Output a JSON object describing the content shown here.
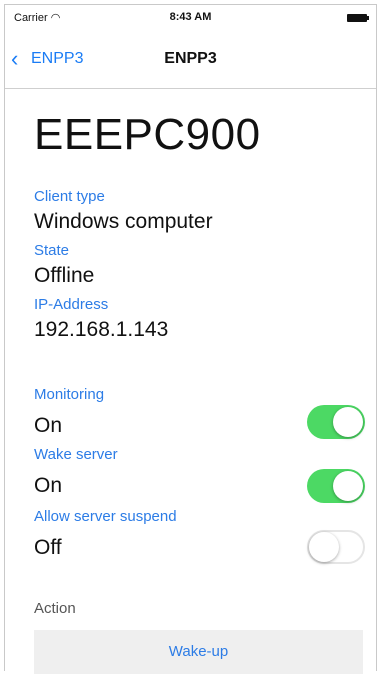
{
  "status_bar": {
    "carrier": "Carrier",
    "time": "8:43 AM"
  },
  "nav": {
    "back_label": "ENPP3",
    "title": "ENPP3"
  },
  "device": {
    "name": "EEEPC900",
    "client_type_label": "Client type",
    "client_type": "Windows computer",
    "state_label": "State",
    "state": "Offline",
    "ip_label": "IP-Address",
    "ip": "192.168.1.143"
  },
  "settings": {
    "monitoring_label": "Monitoring",
    "monitoring_value": "On",
    "monitoring_on": true,
    "wake_server_label": "Wake server",
    "wake_server_value": "On",
    "wake_server_on": true,
    "suspend_label": "Allow server suspend",
    "suspend_value": "Off",
    "suspend_on": false
  },
  "action": {
    "label": "Action",
    "button": "Wake-up"
  },
  "colors": {
    "accent": "#2c7ce6",
    "toggle_on": "#4cd964"
  }
}
